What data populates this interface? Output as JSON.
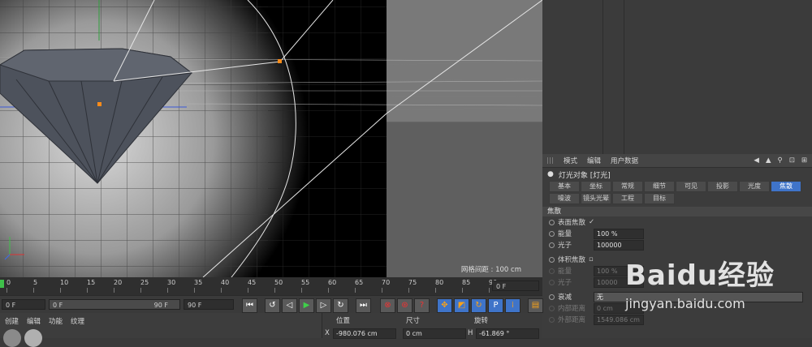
{
  "viewport": {
    "grid_spacing_label": "网格间距 : 100 cm"
  },
  "attributes": {
    "menu": [
      "模式",
      "编辑",
      "用户数据"
    ],
    "object_title": "灯光对象 [灯光]",
    "tabs_row1": [
      "基本",
      "坐标",
      "常规",
      "细节",
      "可见",
      "投影",
      "光度",
      "焦散"
    ],
    "tabs_row2": [
      "噪波",
      "镜头光晕",
      "工程",
      "目标"
    ],
    "active_tab": "焦散",
    "section_title": "焦散",
    "surface_caustics_label": "表面焦散",
    "surface_caustics_check": "✓",
    "energy_label": "能量",
    "energy_value": "100 %",
    "photons_label": "光子",
    "photons_value": "100000",
    "volume_caustics_label": "体积焦散",
    "vol_energy_label": "能量",
    "vol_energy_value": "100 %",
    "vol_photons_label": "光子",
    "vol_photons_value": "10000",
    "falloff_label": "衰减",
    "falloff_value": "无",
    "inner_distance_label": "内部距离",
    "inner_distance_value": "0 cm",
    "outer_distance_label": "外部距离",
    "outer_distance_value": "1549.086 cm"
  },
  "timeline": {
    "ticks": [
      "0",
      "5",
      "10",
      "15",
      "20",
      "25",
      "30",
      "35",
      "40",
      "45",
      "50",
      "55",
      "60",
      "65",
      "70",
      "75",
      "80",
      "85",
      "90"
    ],
    "current_frame_field": "0 F"
  },
  "transport": {
    "start_field": "0 F",
    "range_start": "0 F",
    "range_end": "90 F",
    "end_field": "90 F"
  },
  "bottom": {
    "menu": [
      "创建",
      "编辑",
      "功能",
      "纹理"
    ],
    "coord_headers": [
      "位置",
      "尺寸",
      "旋转"
    ],
    "pos_x_label": "X",
    "pos_x_value": "-980.076 cm",
    "size_x_value": "0 cm",
    "rot_h_label": "H",
    "rot_h_value": "-61.869 °"
  },
  "watermark": {
    "brand": "Baidu经验",
    "url": "jingyan.baidu.com"
  }
}
